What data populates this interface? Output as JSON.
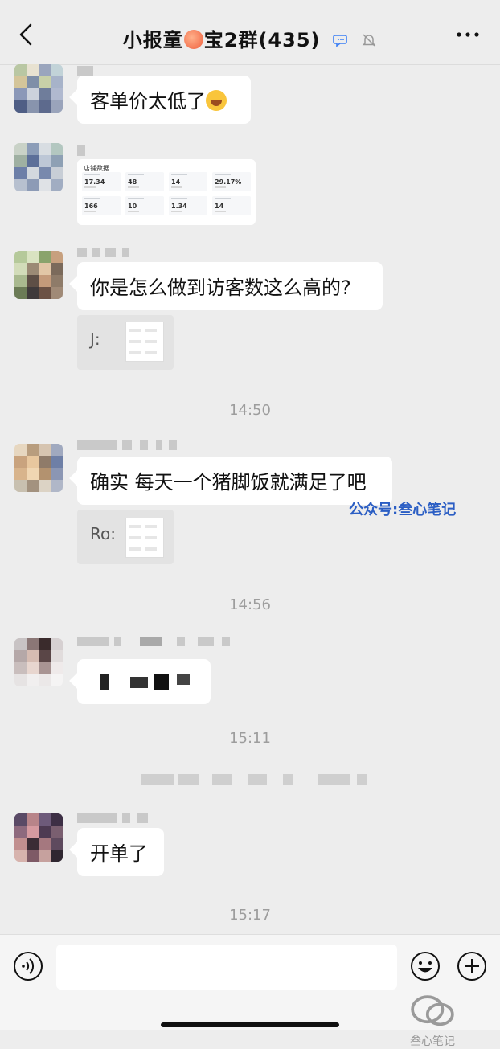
{
  "header": {
    "title_prefix": "小报童",
    "title_suffix": "宝2群(435)"
  },
  "messages": {
    "m1_text": "客单价太低了",
    "card": {
      "title": "店铺数据",
      "values": [
        "17.34",
        "48",
        "14",
        "29.17%",
        "166",
        "10",
        "1.34",
        "14"
      ]
    },
    "m3_text": "你是怎么做到访客数这么高的?",
    "q1_prefix": "J:",
    "m4_text": "确实 每天一个猪脚饭就满足了吧",
    "q2_prefix": "Ro:",
    "m6_text": "开单了"
  },
  "timestamps": [
    "14:50",
    "14:56",
    "15:11",
    "15:17"
  ],
  "watermark": "公众号:叁心笔记",
  "footer_mark": "叁心笔记",
  "colors": {
    "background": "#ededed",
    "bubble": "#ffffff",
    "watermark": "#2b5ec4"
  }
}
